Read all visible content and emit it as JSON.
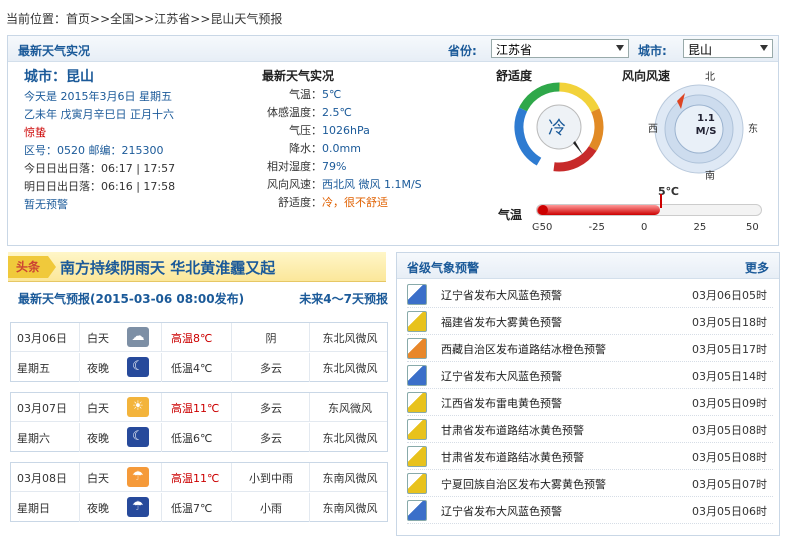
{
  "breadcrumb": {
    "prefix": "当前位置：",
    "home": "首页",
    "sep": ">>",
    "country": "全国",
    "province": "江苏省",
    "current": "昆山天气预报"
  },
  "header": {
    "title": "最新天气实况",
    "province_label": "省份:",
    "province_value": "江苏省",
    "city_label": "城市:",
    "city_value": "昆山"
  },
  "info": {
    "city": "城市：昆山",
    "date": "今天是 2015年3月6日 星期五",
    "lunar": "乙未年 戊寅月辛巳日 正月十六",
    "solar_term": "惊蛰",
    "codes": "区号：0520  邮编：215300",
    "sun_today": "今日日出日落：06:17 | 17:57",
    "sun_tomorrow": "明日日出日落：06:16 | 17:58",
    "warning": "暂无预警"
  },
  "live": {
    "title": "最新天气实况",
    "temp_label": "气温：",
    "temp": "5℃",
    "feel_label": "体感温度：",
    "feel": "2.5℃",
    "pressure_label": "气压：",
    "pressure": "1026hPa",
    "rain_label": "降水：",
    "rain": "0.0mm",
    "humidity_label": "相对湿度：",
    "humidity": "79%",
    "wind_label": "风向风速：",
    "wind": "西北风 微风 1.1M/S",
    "comfort_label": "舒适度：",
    "comfort": "冷，很不舒适"
  },
  "gauges": {
    "comfort_title": "舒适度",
    "comfort_value": "冷",
    "wind_title": "风向风速",
    "wind_value_line1": "1.1",
    "wind_value_line2": "M/S",
    "north": "北",
    "south": "南",
    "east": "东",
    "west": "西",
    "temp_title": "气温",
    "temp_value": "5℃",
    "temp_unit": "C",
    "temp_ticks": [
      "-50",
      "-25",
      "0",
      "25",
      "50"
    ],
    "temp_current": 5
  },
  "headline": {
    "tag": "头条",
    "text": "南方持续阴雨天  华北黄淮霾又起"
  },
  "forecast": {
    "title": "最新天气预报(2015-03-06 08:00发布)",
    "more": "未来4～7天预报",
    "days": [
      {
        "date": "03月06日",
        "week": "星期五",
        "day": {
          "period": "白天",
          "temp": "高温8℃",
          "wx": "阴",
          "wind": "东北风微风",
          "icon": "overcast-icon"
        },
        "night": {
          "period": "夜晚",
          "temp": "低温4℃",
          "wx": "多云",
          "wind": "东北风微风",
          "icon": "moon-cloud-icon"
        }
      },
      {
        "date": "03月07日",
        "week": "星期六",
        "day": {
          "period": "白天",
          "temp": "高温11℃",
          "wx": "多云",
          "wind": "东风微风",
          "icon": "sun-cloud-icon"
        },
        "night": {
          "period": "夜晚",
          "temp": "低温6℃",
          "wx": "多云",
          "wind": "东北风微风",
          "icon": "moon-cloud-icon"
        }
      },
      {
        "date": "03月08日",
        "week": "星期日",
        "day": {
          "period": "白天",
          "temp": "高温11℃",
          "wx": "小到中雨",
          "wind": "东南风微风",
          "icon": "rain-icon"
        },
        "night": {
          "period": "夜晚",
          "temp": "低温7℃",
          "wx": "小雨",
          "wind": "东南风微风",
          "icon": "night-rain-icon"
        }
      }
    ]
  },
  "alerts": {
    "title": "省级气象预警",
    "more": "更多",
    "items": [
      {
        "text": "辽宁省发布大风蓝色预警",
        "date": "03月06日05时",
        "color": "#3b6fc9"
      },
      {
        "text": "福建省发布大雾黄色预警",
        "date": "03月05日18时",
        "color": "#e8c21c"
      },
      {
        "text": "西藏自治区发布道路结冰橙色预警",
        "date": "03月05日17时",
        "color": "#e8872a"
      },
      {
        "text": "辽宁省发布大风蓝色预警",
        "date": "03月05日14时",
        "color": "#3b6fc9"
      },
      {
        "text": "江西省发布雷电黄色预警",
        "date": "03月05日09时",
        "color": "#e8c21c"
      },
      {
        "text": "甘肃省发布道路结冰黄色预警",
        "date": "03月05日08时",
        "color": "#e8c21c"
      },
      {
        "text": "甘肃省发布道路结冰黄色预警",
        "date": "03月05日08时",
        "color": "#e8c21c"
      },
      {
        "text": "宁夏回族自治区发布大雾黄色预警",
        "date": "03月05日07时",
        "color": "#e8c21c"
      },
      {
        "text": "辽宁省发布大风蓝色预警",
        "date": "03月05日06时",
        "color": "#3b6fc9"
      }
    ]
  }
}
